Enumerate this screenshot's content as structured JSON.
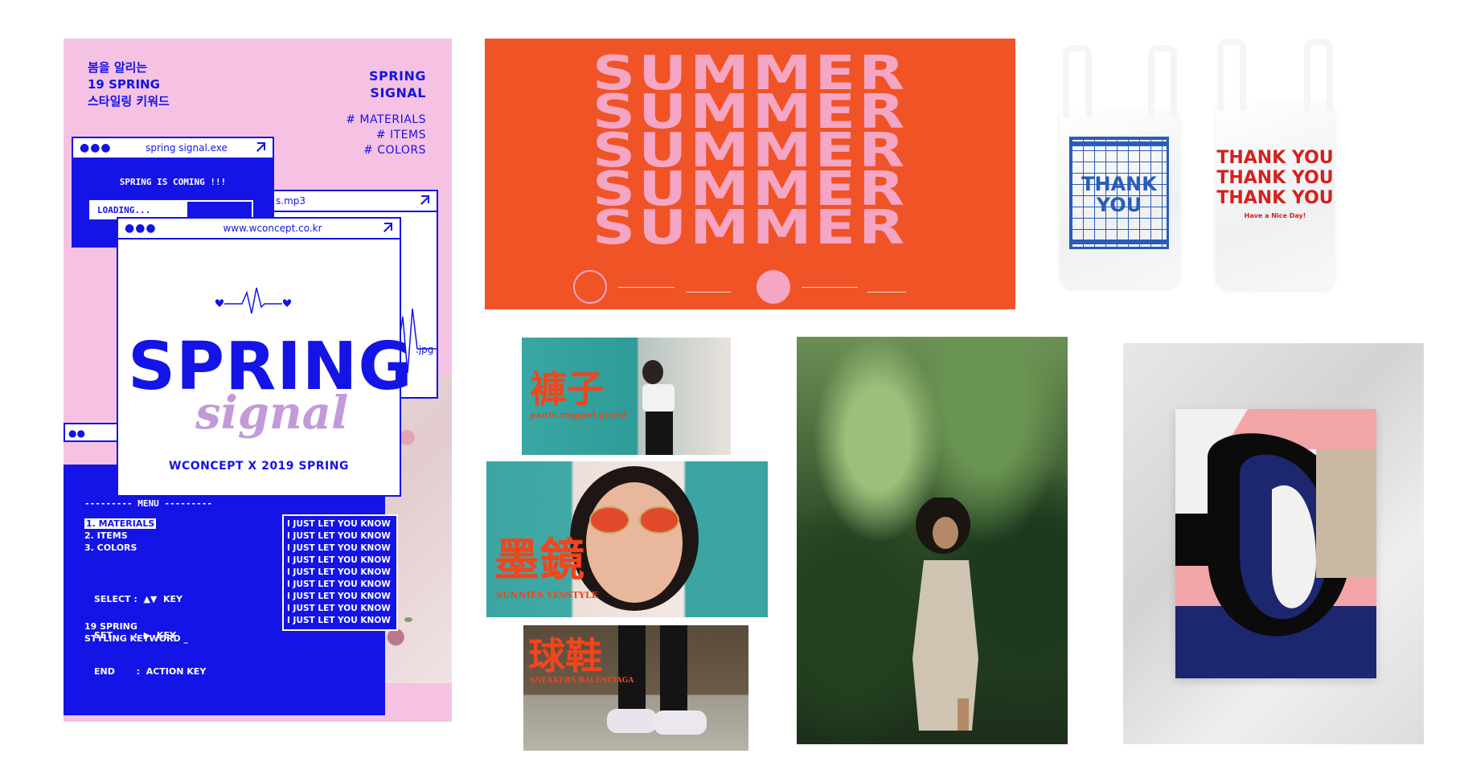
{
  "poster": {
    "korean_title": [
      "봄을 알리는",
      "19 SPRING",
      "스타일링 키워드"
    ],
    "headline": [
      "SPRING",
      "SIGNAL"
    ],
    "tags": [
      "# MATERIALS",
      "# ITEMS",
      "# COLORS"
    ],
    "window1": {
      "title": "spring signal.exe",
      "message": "SPRING IS COMING !!!",
      "loading": "LOADING..."
    },
    "window2": {
      "title": "s.mp3",
      "file2": ".jpg"
    },
    "window3": {
      "title": "www.wconcept.co.kr",
      "big": "SPRING",
      "script": "signal",
      "credit": "WCONCEPT  X  2019 SPRING"
    },
    "menu": {
      "header": "--------- MENU ---------",
      "items": [
        "1. MATERIALS",
        "2. ITEMS",
        "3. COLORS"
      ],
      "keys": [
        "SELECT :  ▲▼  KEY",
        "SET       :  ▶  KEY",
        "END       :  ACTION KEY"
      ],
      "footer": [
        "19 SPRING",
        "STYLING KEYWORD _"
      ]
    },
    "just_let_you_know": [
      "I JUST LET YOU KNOW",
      "I JUST LET YOU KNOW",
      "I JUST LET YOU KNOW",
      "I JUST LET YOU KNOW",
      "I JUST LET YOU KNOW",
      "I JUST LET YOU KNOW",
      "I JUST LET YOU KNOW",
      "I JUST LET YOU KNOW",
      "I JUST LET YOU KNOW"
    ]
  },
  "summer": {
    "lines": [
      "SUMMER",
      "SUMMER",
      "SUMMER",
      "SUMMER",
      "SUMMER"
    ]
  },
  "bags": {
    "blue_bag": [
      "THANK",
      "YOU"
    ],
    "red_bag": [
      "THANK YOU",
      "THANK YOU",
      "THANK YOU"
    ],
    "red_bag_sub": "Have a Nice Day!"
  },
  "photos": {
    "pants": {
      "cn": "褲子",
      "sub": "pants rugged priest"
    },
    "sunnies": {
      "cn": "墨鏡",
      "sub": "SUNNIES YESSTYLE"
    },
    "sneakers": {
      "cn": "球鞋",
      "sub": "SNEAKERS BALENCIAGA"
    }
  },
  "colors": {
    "poster_pink": "#f6c2e3",
    "poster_blue": "#1414e6",
    "summer_orange": "#f05326",
    "summer_pink": "#f6a6c5",
    "bag_blue": "#2a5cb8",
    "bag_red": "#d4211d"
  }
}
